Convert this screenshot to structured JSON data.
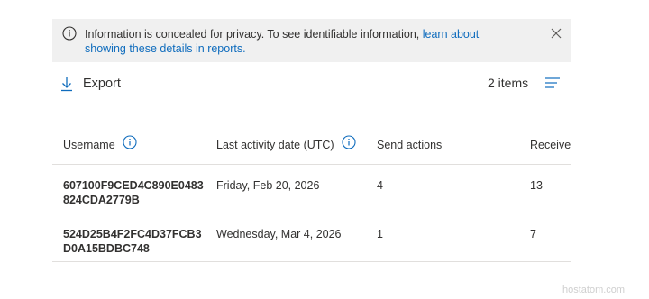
{
  "banner": {
    "message": "Information is concealed for privacy. To see identifiable information, ",
    "link_text": "learn about showing these details in reports."
  },
  "toolbar": {
    "export_label": "Export",
    "item_count": "2 items"
  },
  "table": {
    "columns": [
      {
        "label": "Username",
        "info": true
      },
      {
        "label": "Last activity date (UTC)",
        "info": true
      },
      {
        "label": "Send actions",
        "info": false
      },
      {
        "label": "Receive a",
        "info": false
      }
    ],
    "rows": [
      {
        "username": "607100F9CED4C890E0483824CDA2779B",
        "last_activity": "Friday, Feb 20, 2026",
        "send": "4",
        "receive": "13"
      },
      {
        "username": "524D25B4F2FC4D37FCB3D0A15BDBC748",
        "last_activity": "Wednesday, Mar 4, 2026",
        "send": "1",
        "receive": "7"
      }
    ]
  },
  "watermark": "hostatom.com",
  "colors": {
    "link": "#0f6cbd",
    "banner_bg": "#f0f0f0",
    "icon_blue": "#0f6cbd",
    "divider": "#e1dfdd"
  }
}
